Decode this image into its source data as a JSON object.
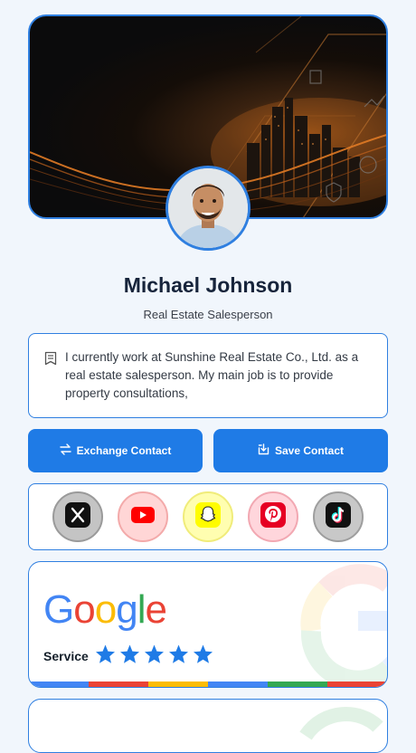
{
  "profile": {
    "name": "Michael Johnson",
    "title": "Real Estate Salesperson",
    "bio": "I currently work at Sunshine Real Estate Co., Ltd. as a real estate salesperson. My main job is to provide property consultations,"
  },
  "actions": {
    "exchange_label": "Exchange Contact",
    "save_label": "Save Contact"
  },
  "social": [
    {
      "name": "x-icon",
      "color": "#1a1a1a"
    },
    {
      "name": "youtube-icon",
      "color": "#ff0000"
    },
    {
      "name": "snapchat-icon",
      "color": "#fffc00"
    },
    {
      "name": "pinterest-icon",
      "color": "#e60023"
    },
    {
      "name": "tiktok-icon",
      "color": "#111111"
    }
  ],
  "google": {
    "logo_letters": [
      "G",
      "o",
      "o",
      "g",
      "l",
      "e"
    ],
    "service_label": "Service",
    "rating": 5,
    "rating_max": 5
  },
  "colors": {
    "accent": "#1f7be6",
    "border": "#2f7fe0",
    "google_blue": "#4285f4",
    "google_red": "#ea4335",
    "google_yellow": "#fbbc05",
    "google_green": "#34a853"
  }
}
